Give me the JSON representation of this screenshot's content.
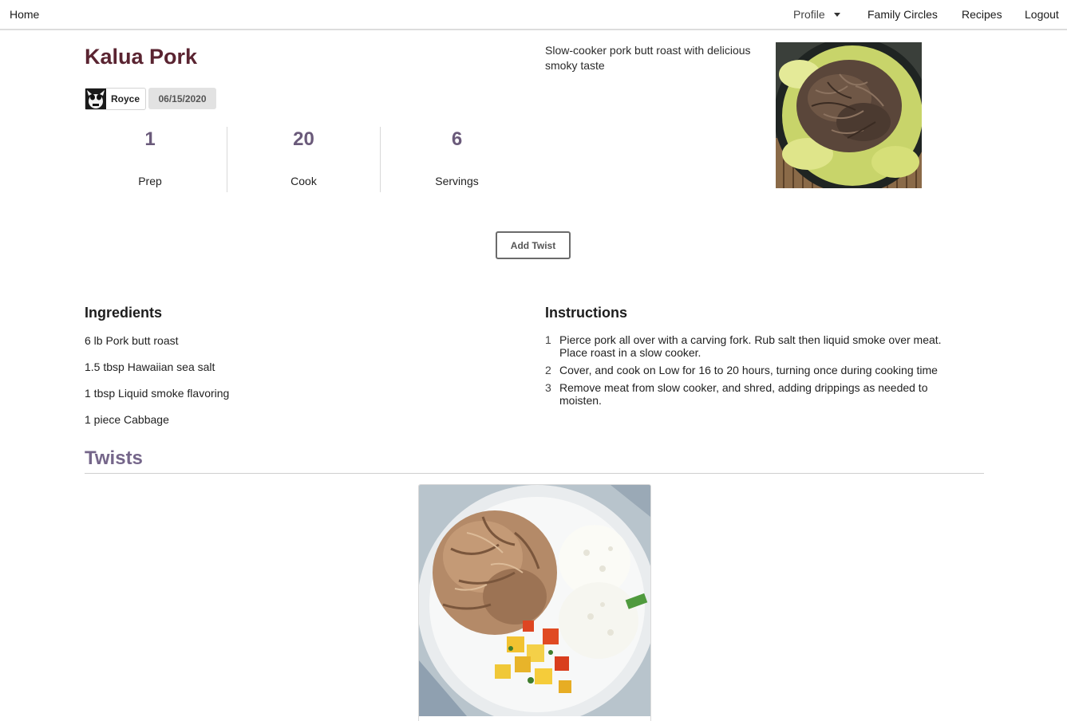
{
  "nav": {
    "home": "Home",
    "profile": "Profile",
    "family_circles": "Family Circles",
    "recipes": "Recipes",
    "logout": "Logout"
  },
  "recipe": {
    "title": "Kalua Pork",
    "author": "Royce",
    "date": "06/15/2020",
    "description": "Slow-cooker pork butt roast with delicious smoky taste",
    "stats": [
      {
        "value": "1",
        "label": "Prep"
      },
      {
        "value": "20",
        "label": "Cook"
      },
      {
        "value": "6",
        "label": "Servings"
      }
    ],
    "add_twist_label": "Add Twist"
  },
  "ingredients": {
    "heading": "Ingredients",
    "items": [
      "6 lb Pork butt roast",
      "1.5 tbsp Hawaiian sea salt",
      "1 tbsp Liquid smoke flavoring",
      "1 piece Cabbage"
    ]
  },
  "instructions": {
    "heading": "Instructions",
    "steps": [
      {
        "num": "1",
        "text": "Pierce pork all over with a carving fork. Rub salt then liquid smoke over meat. Place roast in a slow cooker."
      },
      {
        "num": "2",
        "text": "Cover, and cook on Low for 16 to 20 hours, turning once during cooking time"
      },
      {
        "num": "3",
        "text": "Remove meat from slow cooker, and shred, adding drippings as needed to moisten."
      }
    ]
  },
  "twists": {
    "heading": "Twists"
  },
  "colors": {
    "title": "#5a2431",
    "accent": "#75668a",
    "stat_value": "#6a5a7a"
  }
}
